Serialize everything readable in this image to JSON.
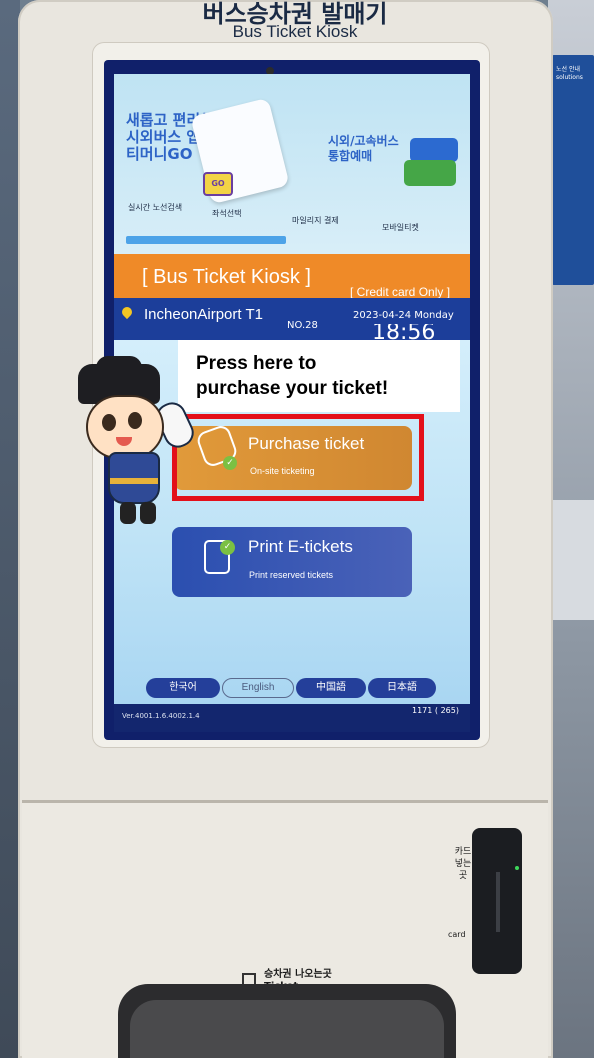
{
  "kiosk": {
    "header_ko": "버스승차권 발매기",
    "header_en": "Bus Ticket Kiosk"
  },
  "banner": {
    "app_title": "새롭고 편리해진\n시외버스 앱\n티머니GO",
    "go_badge": "GO",
    "right_title": "시외/고속버스\n통합예매",
    "features": [
      "실시간 노선검색",
      "좌석선택",
      "마일리지 결제",
      "모바일티켓"
    ]
  },
  "title_bar": {
    "title": "[ Bus Ticket Kiosk ]",
    "payment_note": "[ Credit card Only ]"
  },
  "location_bar": {
    "location": "IncheonAirport T1",
    "number": "NO.28",
    "date": "2023-04-24 Monday",
    "time": "18:56"
  },
  "callout": {
    "text": "Press here to\npurchase your ticket!"
  },
  "menu": {
    "purchase": {
      "label": "Purchase ticket",
      "sub": "On-site ticketing"
    },
    "print": {
      "label": "Print E-tickets",
      "sub": "Print reserved tickets"
    }
  },
  "languages": [
    "한국어",
    "English",
    "中国語",
    "日本語"
  ],
  "footer": {
    "version": "Ver.4001.1.6.4002.1.4",
    "counter": "1171 ( 265)"
  },
  "cabinet": {
    "card_label_ko": "카드\n넣는곳",
    "card_label_en": "card",
    "ticket_label": "승차권 나오는곳\nTicket"
  },
  "side_sign": "노선 안내\nsolutions",
  "colors": {
    "orange_bar": "#ef8a28",
    "location_bar": "#1c3e9a",
    "purchase_button": "#e19a3a",
    "print_button": "#2b4fb0",
    "highlight": "#e3101a"
  }
}
